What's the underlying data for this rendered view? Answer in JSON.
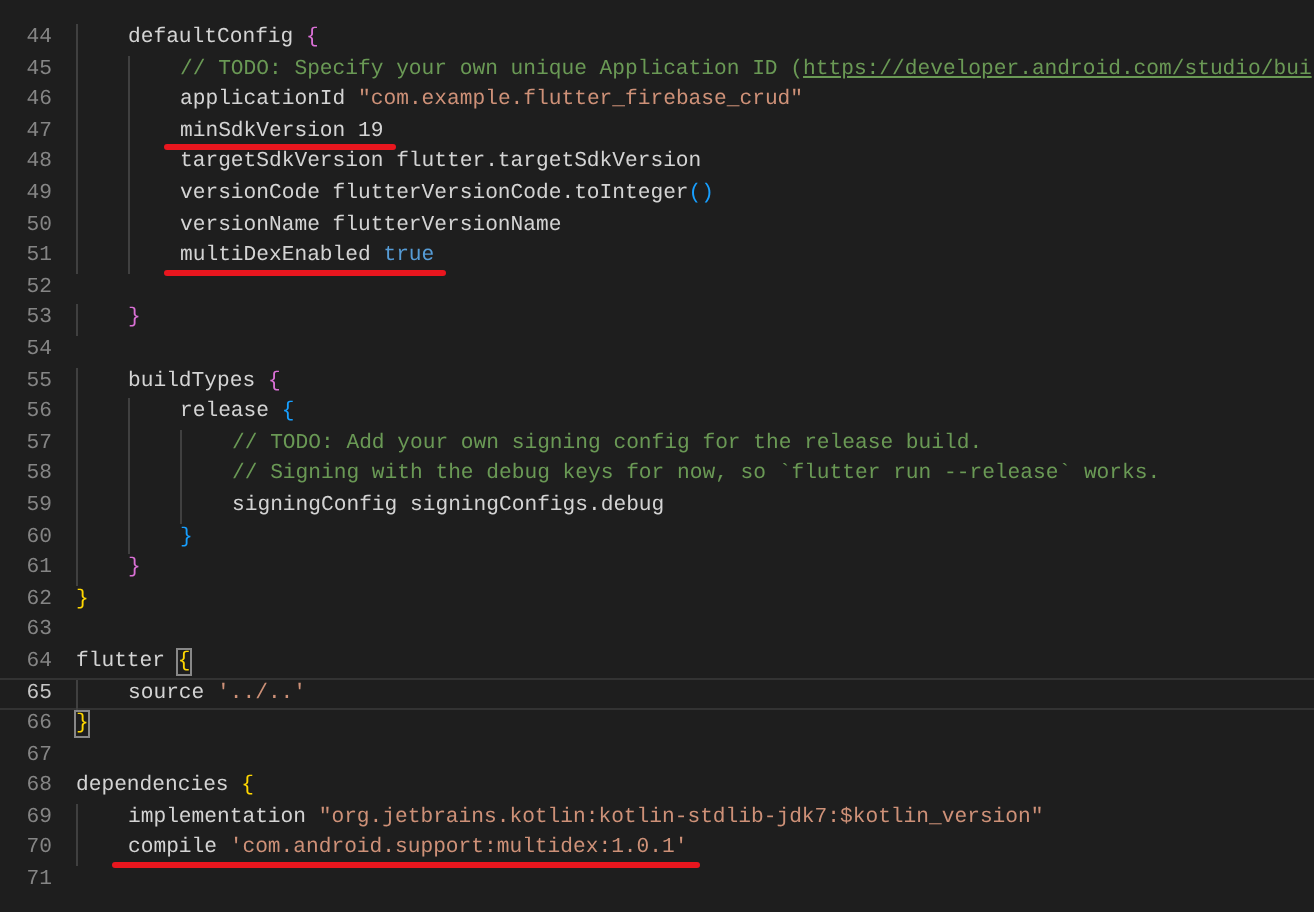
{
  "lines": [
    {
      "number": "44",
      "current": false,
      "tokens": [
        {
          "kind": "plain",
          "text": "    defaultConfig "
        },
        {
          "kind": "brace",
          "color": "#da70d6",
          "text": "{"
        }
      ]
    },
    {
      "number": "45",
      "current": false,
      "tokens": [
        {
          "kind": "comment",
          "text": "        // TODO: Specify your own unique Application ID ("
        },
        {
          "kind": "link",
          "text": "https://developer.android.com/studio/bui"
        }
      ]
    },
    {
      "number": "46",
      "current": false,
      "tokens": [
        {
          "kind": "plain",
          "text": "        applicationId "
        },
        {
          "kind": "string",
          "text": "\"com.example.flutter_firebase_crud\""
        }
      ]
    },
    {
      "number": "47",
      "current": false,
      "marked": true,
      "tokens": [
        {
          "kind": "plain",
          "text": "        minSdkVersion 19"
        }
      ]
    },
    {
      "number": "48",
      "current": false,
      "tokens": [
        {
          "kind": "plain",
          "text": "        targetSdkVersion flutter.targetSdkVersion"
        }
      ]
    },
    {
      "number": "49",
      "current": false,
      "tokens": [
        {
          "kind": "plain",
          "text": "        versionCode flutterVersionCode.toInteger"
        },
        {
          "kind": "brace",
          "color": "#179fff",
          "text": "()"
        }
      ]
    },
    {
      "number": "50",
      "current": false,
      "tokens": [
        {
          "kind": "plain",
          "text": "        versionName flutterVersionName"
        }
      ]
    },
    {
      "number": "51",
      "current": false,
      "marked": true,
      "tokens": [
        {
          "kind": "plain",
          "text": "        multiDexEnabled "
        },
        {
          "kind": "keyword",
          "text": "true"
        }
      ]
    },
    {
      "number": "52",
      "current": false
    },
    {
      "number": "53",
      "current": false,
      "tokens": [
        {
          "kind": "brace",
          "color": "#da70d6",
          "text": "    }"
        }
      ]
    },
    {
      "number": "54",
      "current": false
    },
    {
      "number": "55",
      "current": false,
      "tokens": [
        {
          "kind": "plain",
          "text": "    buildTypes "
        },
        {
          "kind": "brace",
          "color": "#da70d6",
          "text": "{"
        }
      ]
    },
    {
      "number": "56",
      "current": false,
      "tokens": [
        {
          "kind": "plain",
          "text": "        release "
        },
        {
          "kind": "brace",
          "color": "#179fff",
          "text": "{"
        }
      ]
    },
    {
      "number": "57",
      "current": false,
      "tokens": [
        {
          "kind": "comment",
          "text": "            // TODO: Add your own signing config for the release build."
        }
      ]
    },
    {
      "number": "58",
      "current": false,
      "tokens": [
        {
          "kind": "comment",
          "text": "            // Signing with the debug keys for now, so `flutter run --release` works."
        }
      ]
    },
    {
      "number": "59",
      "current": false,
      "tokens": [
        {
          "kind": "plain",
          "text": "            signingConfig signingConfigs.debug"
        }
      ]
    },
    {
      "number": "60",
      "current": false,
      "tokens": [
        {
          "kind": "brace",
          "color": "#179fff",
          "text": "        }"
        }
      ]
    },
    {
      "number": "61",
      "current": false,
      "tokens": [
        {
          "kind": "brace",
          "color": "#da70d6",
          "text": "    }"
        }
      ]
    },
    {
      "number": "62",
      "current": false,
      "tokens": [
        {
          "kind": "brace",
          "color": "#ffd700",
          "text": "}"
        }
      ]
    },
    {
      "number": "63",
      "current": false
    },
    {
      "number": "64",
      "current": false,
      "tokens": [
        {
          "kind": "plain",
          "text": "flutter "
        },
        {
          "kind": "brace",
          "color": "#ffd700",
          "matched": true,
          "text": "{"
        }
      ]
    },
    {
      "number": "65",
      "current": true,
      "tokens": [
        {
          "kind": "plain",
          "text": "    source "
        },
        {
          "kind": "string",
          "text": "'../..'"
        }
      ]
    },
    {
      "number": "66",
      "current": false,
      "tokens": [
        {
          "kind": "brace",
          "color": "#ffd700",
          "matched": true,
          "text": "}"
        }
      ]
    },
    {
      "number": "67",
      "current": false
    },
    {
      "number": "68",
      "current": false,
      "tokens": [
        {
          "kind": "plain",
          "text": "dependencies "
        },
        {
          "kind": "brace",
          "color": "#ffd700",
          "text": "{"
        }
      ]
    },
    {
      "number": "69",
      "current": false,
      "tokens": [
        {
          "kind": "plain",
          "text": "    implementation "
        },
        {
          "kind": "string",
          "text": "\"org.jetbrains.kotlin:kotlin-stdlib-jdk7:$kotlin_version\""
        }
      ]
    },
    {
      "number": "70",
      "current": false,
      "marked": true,
      "tokens": [
        {
          "kind": "plain",
          "text": "    compile "
        },
        {
          "kind": "string",
          "text": "'com.android.support:multidex:1.0.1'"
        }
      ]
    },
    {
      "number": "71",
      "current": false
    }
  ]
}
